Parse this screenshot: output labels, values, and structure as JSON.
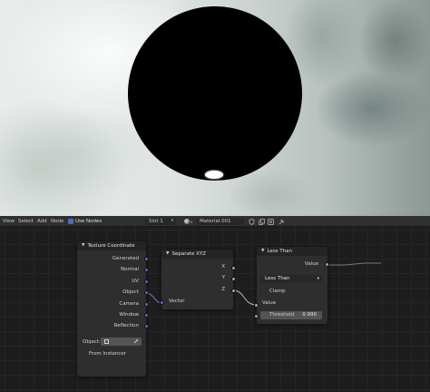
{
  "header": {
    "menu": [
      "View",
      "Select",
      "Add",
      "Node"
    ],
    "use_nodes_label": "Use Nodes",
    "slot": "Slot 1",
    "material_name": "Material.001"
  },
  "nodes": {
    "texture_coordinate": {
      "title": "Texture Coordinate",
      "outputs": [
        "Generated",
        "Normal",
        "UV",
        "Object",
        "Camera",
        "Window",
        "Reflection"
      ],
      "object_label": "Object:",
      "from_instancer_label": "From Instancer"
    },
    "separate_xyz": {
      "title": "Separate XYZ",
      "outputs": [
        "X",
        "Y",
        "Z"
      ],
      "input_label": "Vector"
    },
    "less_than": {
      "title": "Less Than",
      "output_label": "Value",
      "operation": "Less Than",
      "clamp_label": "Clamp",
      "input_label": "Value",
      "threshold_label": "Threshold",
      "threshold_value": "0.990"
    }
  },
  "icons": {
    "vector_socket_color": "#6363c7",
    "float_socket_color": "#a1a1a1",
    "use_nodes_color": "#4772b3"
  }
}
